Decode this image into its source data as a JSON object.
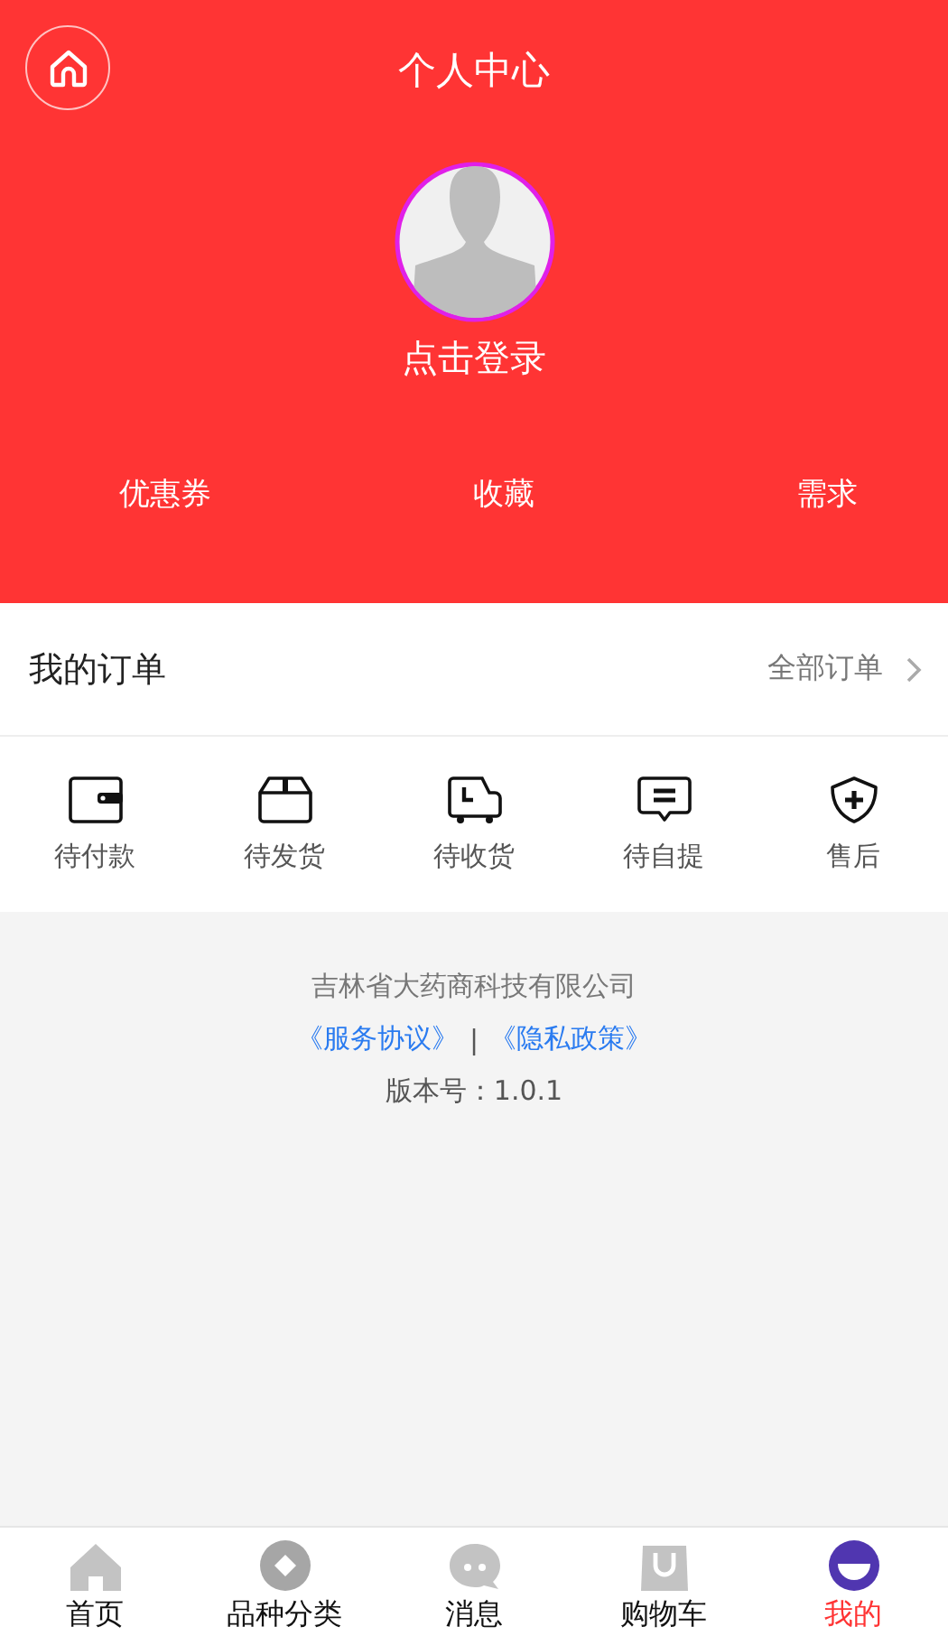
{
  "header": {
    "title": "个人中心",
    "login": "点击登录"
  },
  "shortcuts": [
    "优惠券",
    "收藏",
    "需求"
  ],
  "orders": {
    "title": "我的订单",
    "all": "全部订单",
    "items": [
      {
        "label": "待付款"
      },
      {
        "label": "待发货"
      },
      {
        "label": "待收货"
      },
      {
        "label": "待自提"
      },
      {
        "label": "售后"
      }
    ]
  },
  "footer": {
    "company": "吉林省大药商科技有限公司",
    "links": [
      "《服务协议》",
      "《隐私政策》"
    ],
    "separator": "|",
    "version": "版本号：1.0.1"
  },
  "tabbar": [
    {
      "label": "首页",
      "selected": false
    },
    {
      "label": "品种分类",
      "selected": false
    },
    {
      "label": "消息",
      "selected": false
    },
    {
      "label": "购物车",
      "selected": false
    },
    {
      "label": "我的",
      "selected": true
    }
  ]
}
